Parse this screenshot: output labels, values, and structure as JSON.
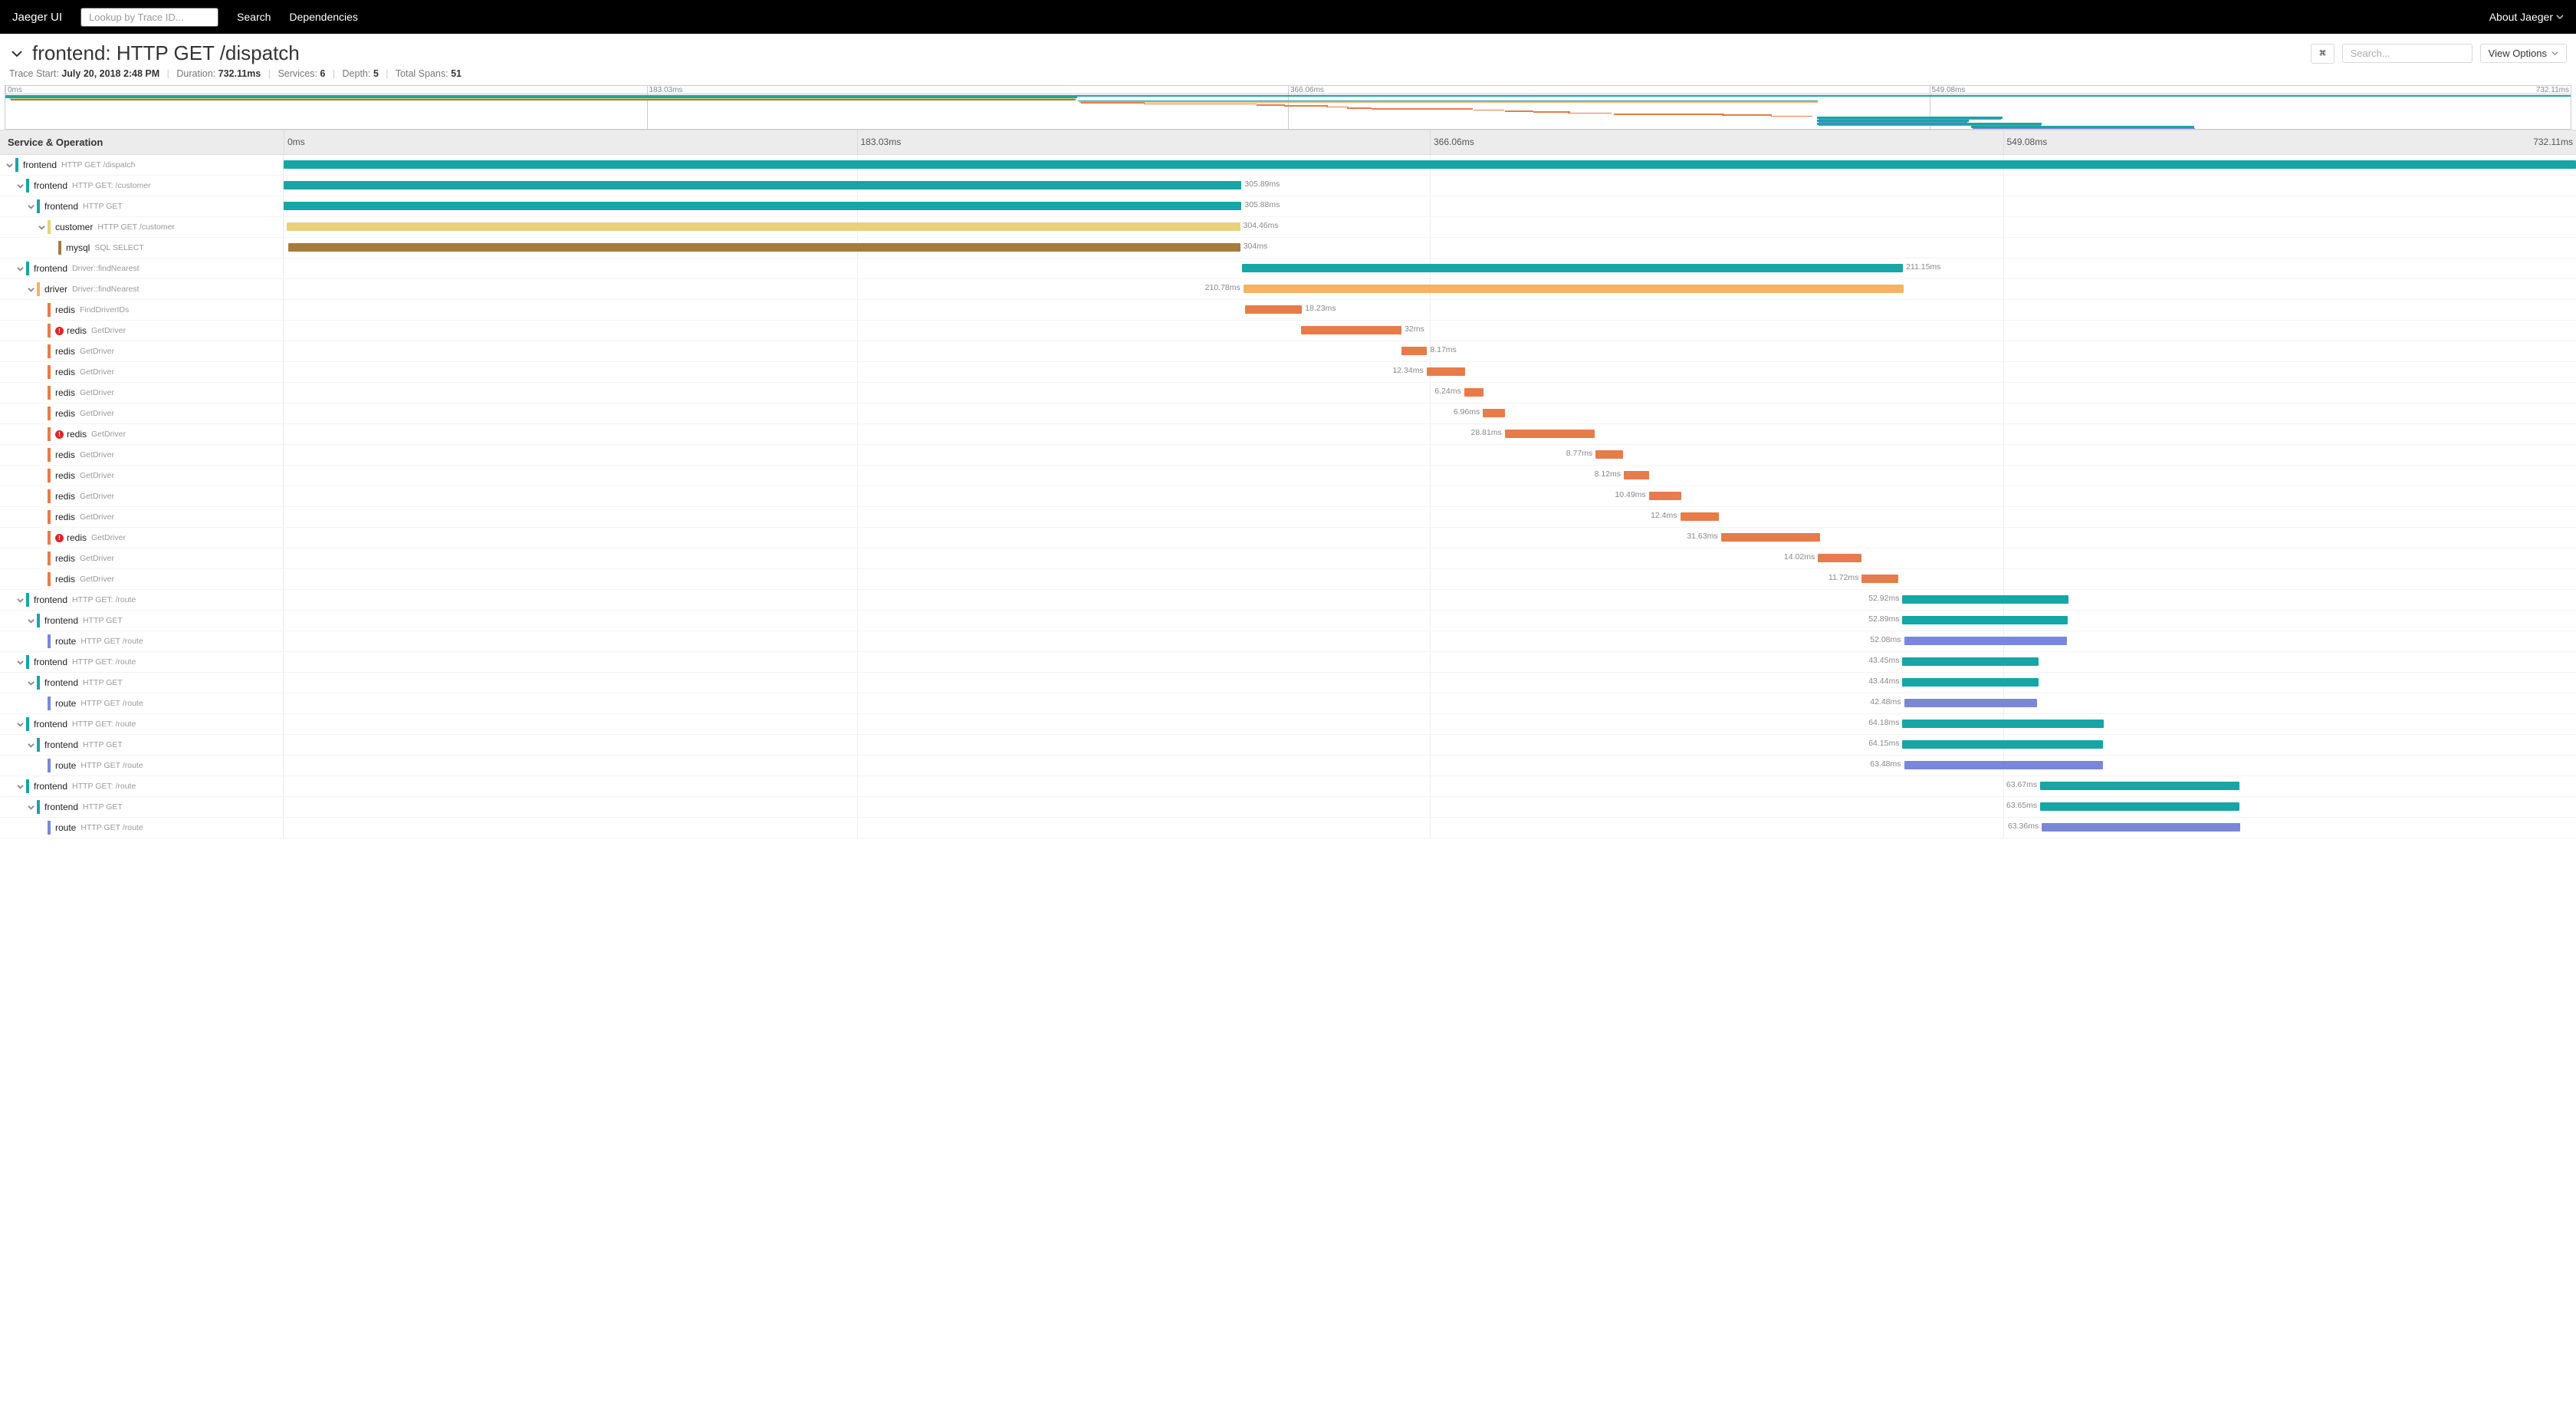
{
  "topbar": {
    "title": "Jaeger UI",
    "lookup_placeholder": "Lookup by Trace ID...",
    "search": "Search",
    "dependencies": "Dependencies",
    "about": "About Jaeger"
  },
  "header": {
    "title": "frontend: HTTP GET /dispatch",
    "search_placeholder": "Search...",
    "view_options": "View Options"
  },
  "meta": {
    "trace_start_label": "Trace Start:",
    "trace_start_value": "July 20, 2018 2:48 PM",
    "duration_label": "Duration:",
    "duration_value": "732.11ms",
    "services_label": "Services:",
    "services_value": "6",
    "depth_label": "Depth:",
    "depth_value": "5",
    "total_spans_label": "Total Spans:",
    "total_spans_value": "51"
  },
  "ticks": [
    "0ms",
    "183.03ms",
    "366.06ms",
    "549.08ms",
    "732.11ms"
  ],
  "col_left_header": "Service & Operation",
  "total_ms": 732.11,
  "colors": {
    "frontend": "#17a5a5",
    "customer": "#e8d17a",
    "mysql": "#a67c3a",
    "driver": "#f2b366",
    "redis": "#e87b4a",
    "route": "#7a87d9"
  },
  "spans": [
    {
      "depth": 0,
      "svc": "frontend",
      "op": "HTTP GET /dispatch",
      "start": 0,
      "dur": 732.11,
      "chev": true,
      "label_side": "none"
    },
    {
      "depth": 1,
      "svc": "frontend",
      "op": "HTTP GET: /customer",
      "start": 0,
      "dur": 305.89,
      "chev": true
    },
    {
      "depth": 2,
      "svc": "frontend",
      "op": "HTTP GET",
      "start": 0,
      "dur": 305.88,
      "chev": true
    },
    {
      "depth": 3,
      "svc": "customer",
      "op": "HTTP GET /customer",
      "start": 1,
      "dur": 304.46,
      "chev": true
    },
    {
      "depth": 4,
      "svc": "mysql",
      "op": "SQL SELECT",
      "start": 1.5,
      "dur": 304,
      "chev": false
    },
    {
      "depth": 1,
      "svc": "frontend",
      "op": "Driver::findNearest",
      "start": 306,
      "dur": 211.15,
      "chev": true
    },
    {
      "depth": 2,
      "svc": "driver",
      "op": "Driver::findNearest",
      "start": 306.5,
      "dur": 210.78,
      "chev": true,
      "label_side": "left"
    },
    {
      "depth": 3,
      "svc": "redis",
      "op": "FindDriverIDs",
      "start": 307,
      "dur": 18.23,
      "chev": false
    },
    {
      "depth": 3,
      "svc": "redis",
      "op": "GetDriver",
      "start": 325,
      "dur": 32,
      "chev": false,
      "error": true
    },
    {
      "depth": 3,
      "svc": "redis",
      "op": "GetDriver",
      "start": 357,
      "dur": 8.17,
      "chev": false
    },
    {
      "depth": 3,
      "svc": "redis",
      "op": "GetDriver",
      "start": 365,
      "dur": 12.34,
      "chev": false,
      "label_side": "left"
    },
    {
      "depth": 3,
      "svc": "redis",
      "op": "GetDriver",
      "start": 377,
      "dur": 6.24,
      "chev": false,
      "label_side": "left"
    },
    {
      "depth": 3,
      "svc": "redis",
      "op": "GetDriver",
      "start": 383,
      "dur": 6.96,
      "chev": false,
      "label_side": "left"
    },
    {
      "depth": 3,
      "svc": "redis",
      "op": "GetDriver",
      "start": 390,
      "dur": 28.81,
      "chev": false,
      "error": true,
      "label_side": "left"
    },
    {
      "depth": 3,
      "svc": "redis",
      "op": "GetDriver",
      "start": 419,
      "dur": 8.77,
      "chev": false,
      "label_side": "left"
    },
    {
      "depth": 3,
      "svc": "redis",
      "op": "GetDriver",
      "start": 428,
      "dur": 8.12,
      "chev": false,
      "label_side": "left"
    },
    {
      "depth": 3,
      "svc": "redis",
      "op": "GetDriver",
      "start": 436,
      "dur": 10.49,
      "chev": false,
      "label_side": "left"
    },
    {
      "depth": 3,
      "svc": "redis",
      "op": "GetDriver",
      "start": 446,
      "dur": 12.4,
      "chev": false,
      "label_side": "left"
    },
    {
      "depth": 3,
      "svc": "redis",
      "op": "GetDriver",
      "start": 459,
      "dur": 31.63,
      "chev": false,
      "error": true,
      "label_side": "left"
    },
    {
      "depth": 3,
      "svc": "redis",
      "op": "GetDriver",
      "start": 490,
      "dur": 14.02,
      "chev": false,
      "label_side": "left"
    },
    {
      "depth": 3,
      "svc": "redis",
      "op": "GetDriver",
      "start": 504,
      "dur": 11.72,
      "chev": false,
      "label_side": "left"
    },
    {
      "depth": 1,
      "svc": "frontend",
      "op": "HTTP GET: /route",
      "start": 517,
      "dur": 52.92,
      "chev": true,
      "label_side": "left"
    },
    {
      "depth": 2,
      "svc": "frontend",
      "op": "HTTP GET",
      "start": 517,
      "dur": 52.89,
      "chev": true,
      "label_side": "left"
    },
    {
      "depth": 3,
      "svc": "route",
      "op": "HTTP GET /route",
      "start": 517.5,
      "dur": 52.08,
      "chev": false,
      "label_side": "left"
    },
    {
      "depth": 1,
      "svc": "frontend",
      "op": "HTTP GET: /route",
      "start": 517,
      "dur": 43.45,
      "chev": true,
      "label_side": "left"
    },
    {
      "depth": 2,
      "svc": "frontend",
      "op": "HTTP GET",
      "start": 517,
      "dur": 43.44,
      "chev": true,
      "label_side": "left"
    },
    {
      "depth": 3,
      "svc": "route",
      "op": "HTTP GET /route",
      "start": 517.5,
      "dur": 42.48,
      "chev": false,
      "label_side": "left"
    },
    {
      "depth": 1,
      "svc": "frontend",
      "op": "HTTP GET: /route",
      "start": 517,
      "dur": 64.18,
      "chev": true,
      "label_side": "left"
    },
    {
      "depth": 2,
      "svc": "frontend",
      "op": "HTTP GET",
      "start": 517,
      "dur": 64.15,
      "chev": true,
      "label_side": "left"
    },
    {
      "depth": 3,
      "svc": "route",
      "op": "HTTP GET /route",
      "start": 517.5,
      "dur": 63.48,
      "chev": false,
      "label_side": "left"
    },
    {
      "depth": 1,
      "svc": "frontend",
      "op": "HTTP GET: /route",
      "start": 561,
      "dur": 63.67,
      "chev": true,
      "label_side": "left"
    },
    {
      "depth": 2,
      "svc": "frontend",
      "op": "HTTP GET",
      "start": 561,
      "dur": 63.65,
      "chev": true,
      "label_side": "left"
    },
    {
      "depth": 3,
      "svc": "route",
      "op": "HTTP GET /route",
      "start": 561.5,
      "dur": 63.36,
      "chev": false,
      "label_side": "left"
    }
  ]
}
